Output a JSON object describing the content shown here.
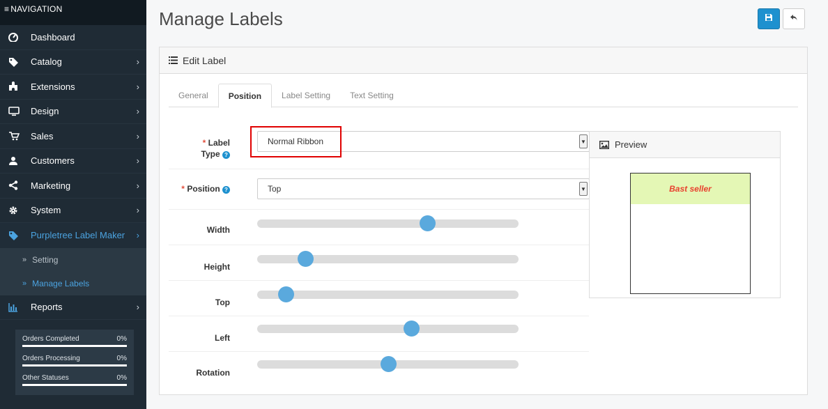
{
  "sidebar": {
    "header": "NAVIGATION",
    "items": [
      {
        "label": "Dashboard",
        "icon": "dashboard-icon",
        "chevron": false
      },
      {
        "label": "Catalog",
        "icon": "tag-icon",
        "chevron": true
      },
      {
        "label": "Extensions",
        "icon": "puzzle-icon",
        "chevron": true
      },
      {
        "label": "Design",
        "icon": "monitor-icon",
        "chevron": true
      },
      {
        "label": "Sales",
        "icon": "cart-icon",
        "chevron": true
      },
      {
        "label": "Customers",
        "icon": "user-icon",
        "chevron": true
      },
      {
        "label": "Marketing",
        "icon": "share-icon",
        "chevron": true
      },
      {
        "label": "System",
        "icon": "gear-icon",
        "chevron": true
      },
      {
        "label": "Purpletree Label Maker",
        "icon": "tag-icon",
        "chevron": true,
        "active": true
      },
      {
        "label": "Reports",
        "icon": "bar-chart-icon",
        "chevron": true
      }
    ],
    "subitems": [
      {
        "label": "Setting"
      },
      {
        "label": "Manage Labels",
        "selected": true
      }
    ],
    "stats": [
      {
        "label": "Orders Completed",
        "value": "0%"
      },
      {
        "label": "Orders Processing",
        "value": "0%"
      },
      {
        "label": "Other Statuses",
        "value": "0%"
      }
    ],
    "chevron": "›",
    "subitem_marker": "»"
  },
  "page": {
    "title": "Manage Labels"
  },
  "toolbar": {
    "save_icon": "save-icon",
    "back_icon": "reply-icon"
  },
  "panel": {
    "title": "Edit Label"
  },
  "tabs": [
    {
      "label": "General"
    },
    {
      "label": "Position",
      "active": true
    },
    {
      "label": "Label Setting"
    },
    {
      "label": "Text Setting"
    }
  ],
  "form": {
    "label_type": {
      "label_line1": "Label",
      "label_line2": "Type",
      "value": "Normal Ribbon"
    },
    "position": {
      "label": "Position",
      "value": "Top"
    },
    "required_marker": "*",
    "help_marker": "?",
    "sliders": [
      {
        "label": "Width",
        "level": 0.65
      },
      {
        "label": "Height",
        "level": 0.185
      },
      {
        "label": "Top",
        "level": 0.11
      },
      {
        "label": "Left",
        "level": 0.59
      },
      {
        "label": "Rotation",
        "level": 0.5
      }
    ]
  },
  "preview": {
    "title": "Preview",
    "ribbon_text": "Bast seller"
  },
  "colors": {
    "accent": "#1e91cf",
    "sidebar_bg": "#1f2b35",
    "ribbon_bg": "#e4f7b5",
    "ribbon_text": "#e8412e",
    "highlight": "#e00000"
  }
}
